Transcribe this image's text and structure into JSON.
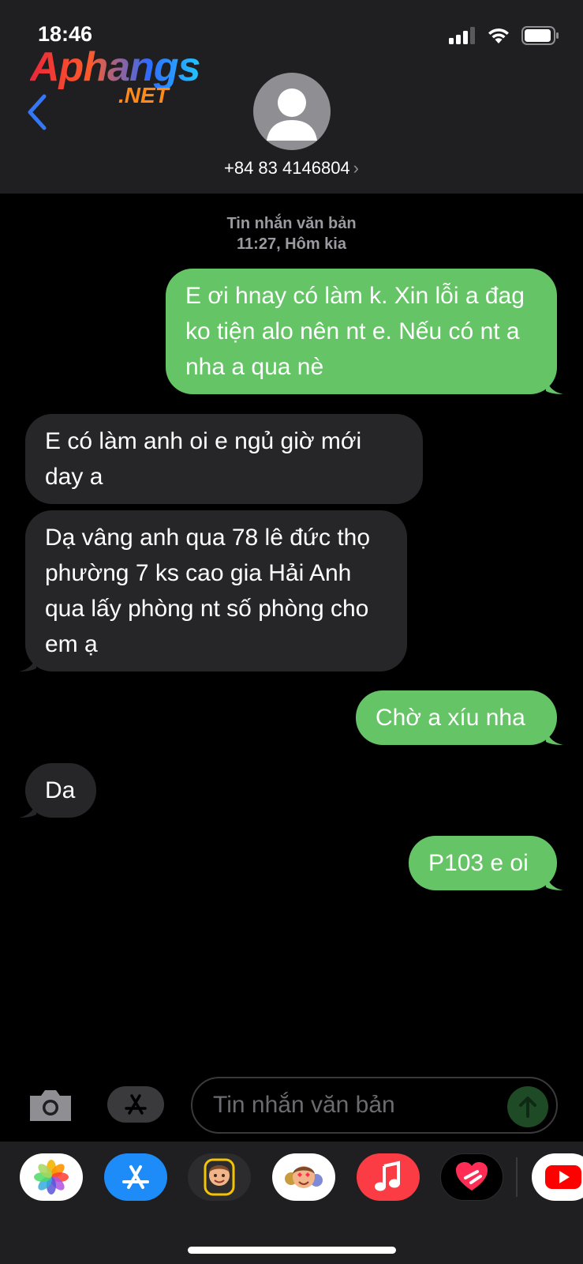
{
  "status_bar": {
    "time": "18:46"
  },
  "logo": {
    "main": "Aphangs",
    "sub": ".NET"
  },
  "header": {
    "contact": "+84 83 4146804",
    "chevron": "›"
  },
  "thread": {
    "service_label": "Tin nhắn văn bản",
    "timestamp": "11:27, Hôm kia",
    "messages": [
      {
        "direction": "outgoing",
        "text": "E ơi hnay có làm k. Xin lỗi a đag ko tiện alo nên nt e. Nếu có nt a nha a qua nè"
      },
      {
        "direction": "incoming",
        "text": "E có làm anh oi e ngủ giờ mới day a"
      },
      {
        "direction": "incoming",
        "text": "Dạ vâng anh qua 78 lê đức thọ phường 7 ks cao gia Hải Anh qua lấy phòng nt số phòng cho em ạ"
      },
      {
        "direction": "outgoing",
        "text": "Chờ a xíu nha"
      },
      {
        "direction": "incoming",
        "text": "Da"
      },
      {
        "direction": "outgoing",
        "text": "P103 e oi"
      }
    ]
  },
  "composer": {
    "placeholder": "Tin nhắn văn bản"
  },
  "dock_apps": [
    "photos-icon",
    "app-store-icon",
    "memoji-icon",
    "animoji-stickers-icon",
    "music-icon",
    "digital-touch-icon",
    "youtube-icon"
  ],
  "colors": {
    "outgoing_bubble": "#65c466",
    "incoming_bubble": "#262628",
    "accent": "#3478f6"
  }
}
